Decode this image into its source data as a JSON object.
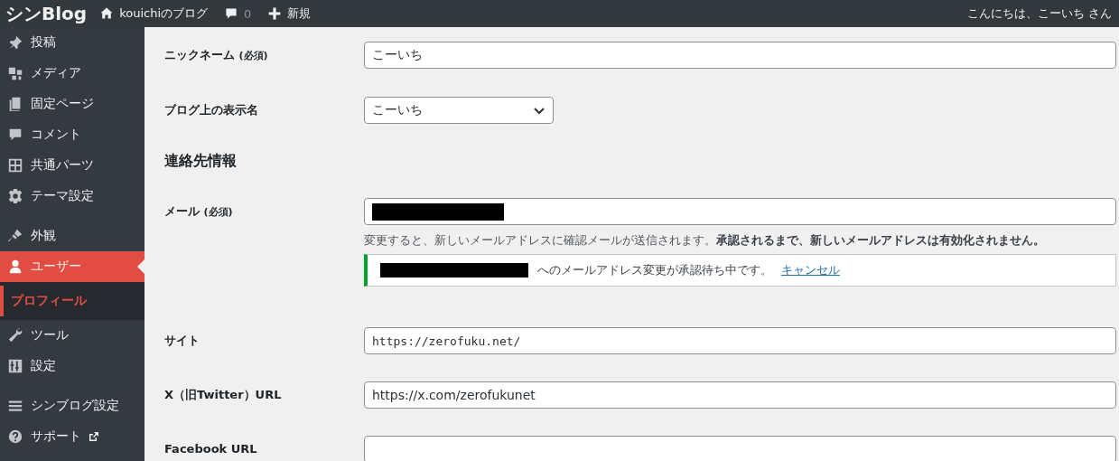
{
  "topbar": {
    "logo": "シンBlog",
    "site_name": "kouichiのブログ",
    "comment_count": "0",
    "new_label": "新規",
    "greeting": "こんにちは、こーいち さん"
  },
  "sidebar": {
    "groups": [
      [
        {
          "label": "投稿",
          "selected": false
        },
        {
          "label": "メディア",
          "selected": false
        },
        {
          "label": "固定ページ",
          "selected": false
        },
        {
          "label": "コメント",
          "selected": false
        },
        {
          "label": "共通パーツ",
          "selected": false
        },
        {
          "label": "テーマ設定",
          "selected": false
        }
      ],
      [
        {
          "label": "外観",
          "selected": false
        },
        {
          "label": "ユーザー",
          "selected": true,
          "children": [
            {
              "label": "プロフィール",
              "selected": true
            }
          ]
        },
        {
          "label": "ツール",
          "selected": false
        },
        {
          "label": "設定",
          "selected": false
        }
      ],
      [
        {
          "label": "シンブログ設定",
          "selected": false
        },
        {
          "label": "サポート",
          "selected": false,
          "external": true
        }
      ]
    ]
  },
  "form": {
    "rows": [
      {
        "kind": "text",
        "label": "ニックネーム",
        "note": "(必須)",
        "value": "こーいち"
      },
      {
        "kind": "select",
        "label": "ブログ上の表示名",
        "value": "こーいち"
      },
      {
        "kind": "heading",
        "label": "連絡先情報"
      },
      {
        "kind": "email",
        "label": "メール",
        "note": "(必須)",
        "description": "変更すると、新しいメールアドレスに確認メールが送信されます。**承認されるまで、新しいメールアドレスは有効化されません。**",
        "notice": {
          "text": "へのメールアドレス変更が承認待ち中です。",
          "link": "キャンセル"
        }
      },
      {
        "kind": "url",
        "label": "サイト",
        "value": "https://zerofuku.net/"
      },
      {
        "kind": "text",
        "label": "X（旧Twitter）URL",
        "value": "https://x.com/zerofukunet"
      },
      {
        "kind": "text",
        "label": "Facebook URL",
        "value": ""
      }
    ]
  }
}
